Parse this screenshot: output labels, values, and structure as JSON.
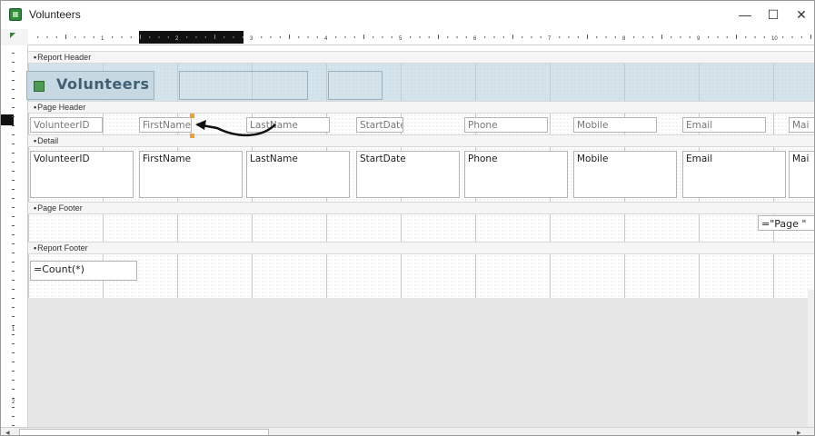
{
  "window": {
    "title": "Volunteers",
    "minimize": "—",
    "maximize": "☐",
    "close": "✕"
  },
  "ruler": {
    "marks": [
      "1",
      "2",
      "3",
      "4",
      "5",
      "6",
      "7",
      "8",
      "9",
      "10"
    ]
  },
  "vruler": {
    "marks": [
      "1",
      "2"
    ]
  },
  "sections": {
    "report_header": "Report Header",
    "page_header": "Page Header",
    "detail": "Detail",
    "page_footer": "Page Footer",
    "report_footer": "Report Footer"
  },
  "report_header": {
    "title": "Volunteers"
  },
  "page_header_labels": [
    "VolunteerID",
    "FirstName",
    "LastName",
    "StartDate",
    "Phone",
    "Mobile",
    "Email",
    "Mai"
  ],
  "detail_fields": [
    "VolunteerID",
    "FirstName",
    "LastName",
    "StartDate",
    "Phone",
    "Mobile",
    "Email",
    "Mai"
  ],
  "page_footer": {
    "page_expr": "=\"Page \""
  },
  "report_footer": {
    "count_expr": "=Count(*)"
  },
  "colors": {
    "header_band": "#d4e4ec",
    "title_text": "#3f5f73",
    "selection_handle": "#f0a030"
  }
}
